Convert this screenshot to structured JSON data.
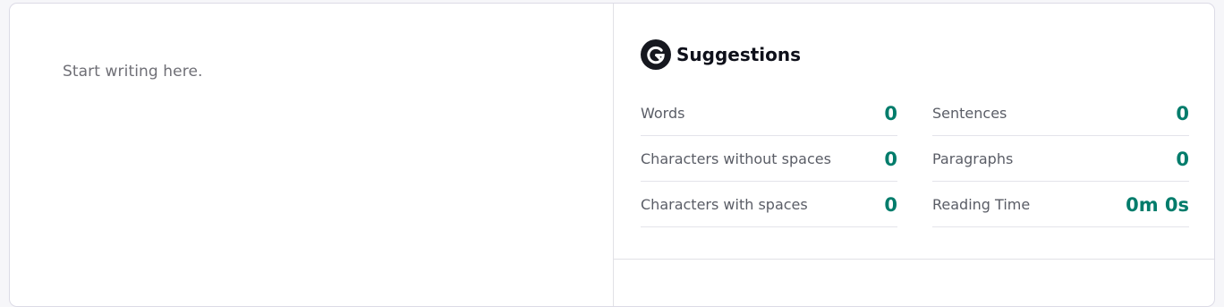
{
  "editor": {
    "placeholder": "Start writing here."
  },
  "panel": {
    "title": "Suggestions",
    "logo_icon": "grammarly-g-icon",
    "accent_color": "#017c6b"
  },
  "stats": {
    "left": [
      {
        "label": "Words",
        "value": "0"
      },
      {
        "label": "Characters without spaces",
        "value": "0"
      },
      {
        "label": "Characters with spaces",
        "value": "0"
      }
    ],
    "right": [
      {
        "label": "Sentences",
        "value": "0"
      },
      {
        "label": "Paragraphs",
        "value": "0"
      },
      {
        "label": "Reading Time",
        "value": "0m 0s"
      }
    ]
  }
}
